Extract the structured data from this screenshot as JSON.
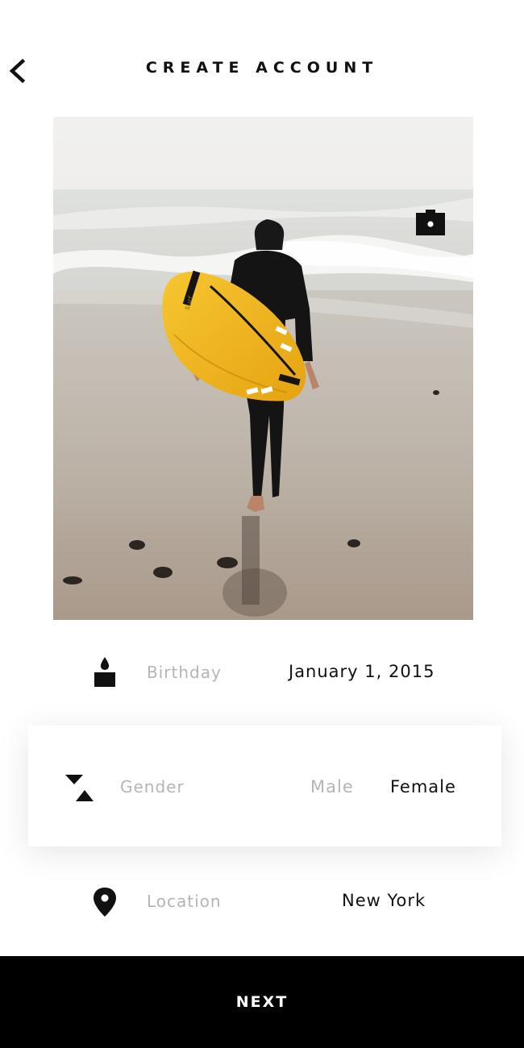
{
  "header": {
    "title": "CREATE ACCOUNT",
    "back_icon": "chevron-left-icon"
  },
  "photo": {
    "subject": "surfer carrying yellow surfboard on beach",
    "camera_icon": "camera-icon"
  },
  "form": {
    "birthday": {
      "icon": "candle-icon",
      "label": "Birthday",
      "value": "January 1, 2015"
    },
    "gender": {
      "icon": "gender-triangles-icon",
      "label": "Gender",
      "options": [
        "Male",
        "Female"
      ],
      "selected": "Female"
    },
    "location": {
      "icon": "map-pin-icon",
      "label": "Location",
      "value": "New York"
    }
  },
  "footer": {
    "next_label": "NEXT"
  },
  "colors": {
    "label_gray": "#b5b5b5",
    "text": "#111111",
    "bar": "#000000",
    "surfboard": "#f2b51c"
  }
}
